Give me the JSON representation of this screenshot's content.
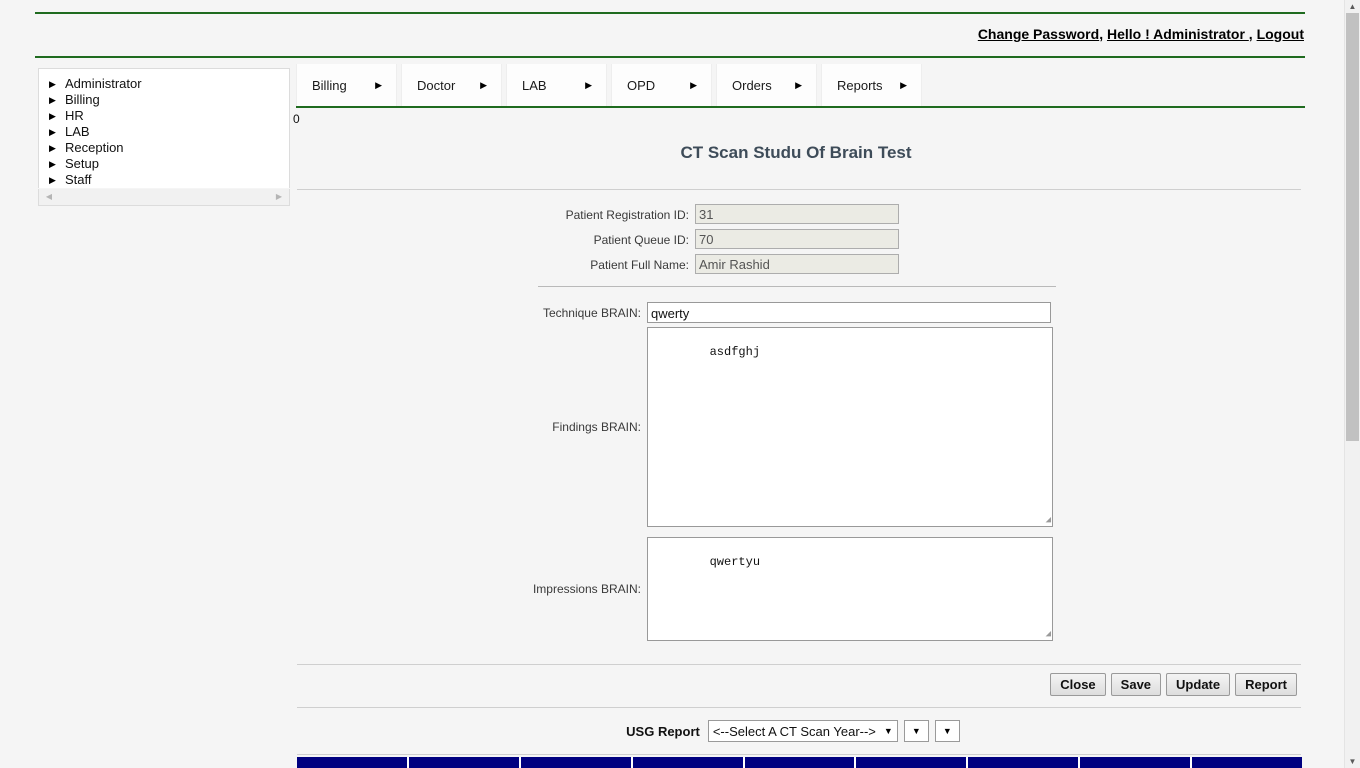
{
  "header": {
    "change_password": "Change Password",
    "separator1": ", ",
    "greeting": "Hello ! Administrator ",
    "separator2": ", ",
    "logout": "Logout"
  },
  "sidebar": {
    "items": [
      {
        "label": "Administrator",
        "caret": "▶"
      },
      {
        "label": "Billing",
        "caret": "▶"
      },
      {
        "label": "HR",
        "caret": "▶"
      },
      {
        "label": "LAB",
        "caret": "▶"
      },
      {
        "label": "Reception",
        "caret": "▶"
      },
      {
        "label": "Setup",
        "caret": "▶"
      },
      {
        "label": "Staff",
        "caret": "▶"
      }
    ],
    "scroll_left": "◀",
    "scroll_right": "▶"
  },
  "menubar": {
    "items": [
      {
        "label": "Billing",
        "arrow": "▶"
      },
      {
        "label": "Doctor",
        "arrow": "▶"
      },
      {
        "label": "LAB",
        "arrow": "▶"
      },
      {
        "label": "OPD",
        "arrow": "▶"
      },
      {
        "label": "Orders",
        "arrow": "▶"
      },
      {
        "label": "Reports",
        "arrow": "▶"
      }
    ]
  },
  "stray_text": "0",
  "main": {
    "title": "CT Scan Studu Of Brain Test",
    "fields": {
      "reg_id_label": "Patient Registration ID:",
      "reg_id_value": "31",
      "queue_id_label": "Patient Queue ID:",
      "queue_id_value": "70",
      "full_name_label": "Patient Full Name:",
      "full_name_value": "Amir Rashid",
      "technique_label": "Technique BRAIN:",
      "technique_value": "qwerty",
      "findings_label": "Findings BRAIN:",
      "findings_value": "asdfghj",
      "impressions_label": "Impressions BRAIN:",
      "impressions_value": "qwertyu"
    },
    "buttons": {
      "close": "Close",
      "save": "Save",
      "update": "Update",
      "report": "Report"
    },
    "usg": {
      "label": "USG Report",
      "year_select_value": "<--Select A CT Scan Year-->",
      "select2_value": "",
      "select3_value": "",
      "arrow": "▼"
    }
  },
  "scrollbar": {
    "up_arrow": "▲",
    "down_arrow": "▼"
  },
  "colors": {
    "accent_green": "#1f6b1f",
    "table_header_blue": "#000080",
    "readonly_field": "#ebebe4",
    "title_text": "#3e4c59"
  }
}
